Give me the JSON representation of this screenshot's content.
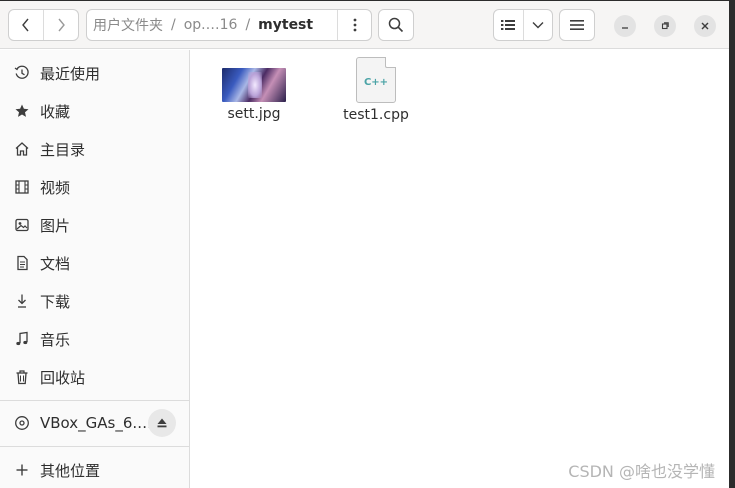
{
  "header": {
    "path": {
      "home": "用户文件夹",
      "middle": "op.…16",
      "current": "mytest",
      "separator": "/"
    }
  },
  "sidebar": {
    "items": [
      {
        "label": "最近使用",
        "icon": "clock-icon"
      },
      {
        "label": "收藏",
        "icon": "star-icon"
      },
      {
        "label": "主目录",
        "icon": "home-icon"
      },
      {
        "label": "视频",
        "icon": "film-icon"
      },
      {
        "label": "图片",
        "icon": "image-icon"
      },
      {
        "label": "文档",
        "icon": "document-icon"
      },
      {
        "label": "下载",
        "icon": "download-icon"
      },
      {
        "label": "音乐",
        "icon": "music-icon"
      },
      {
        "label": "回收站",
        "icon": "trash-icon"
      }
    ],
    "device": {
      "label": "VBox_GAs_6.…",
      "icon": "disc-icon"
    },
    "other": {
      "label": "其他位置",
      "icon": "plus-icon"
    }
  },
  "files": [
    {
      "name": "sett.jpg",
      "type": "image"
    },
    {
      "name": "test1.cpp",
      "type": "cpp",
      "badge": "C++"
    }
  ],
  "watermark": "CSDN @啥也没学懂"
}
